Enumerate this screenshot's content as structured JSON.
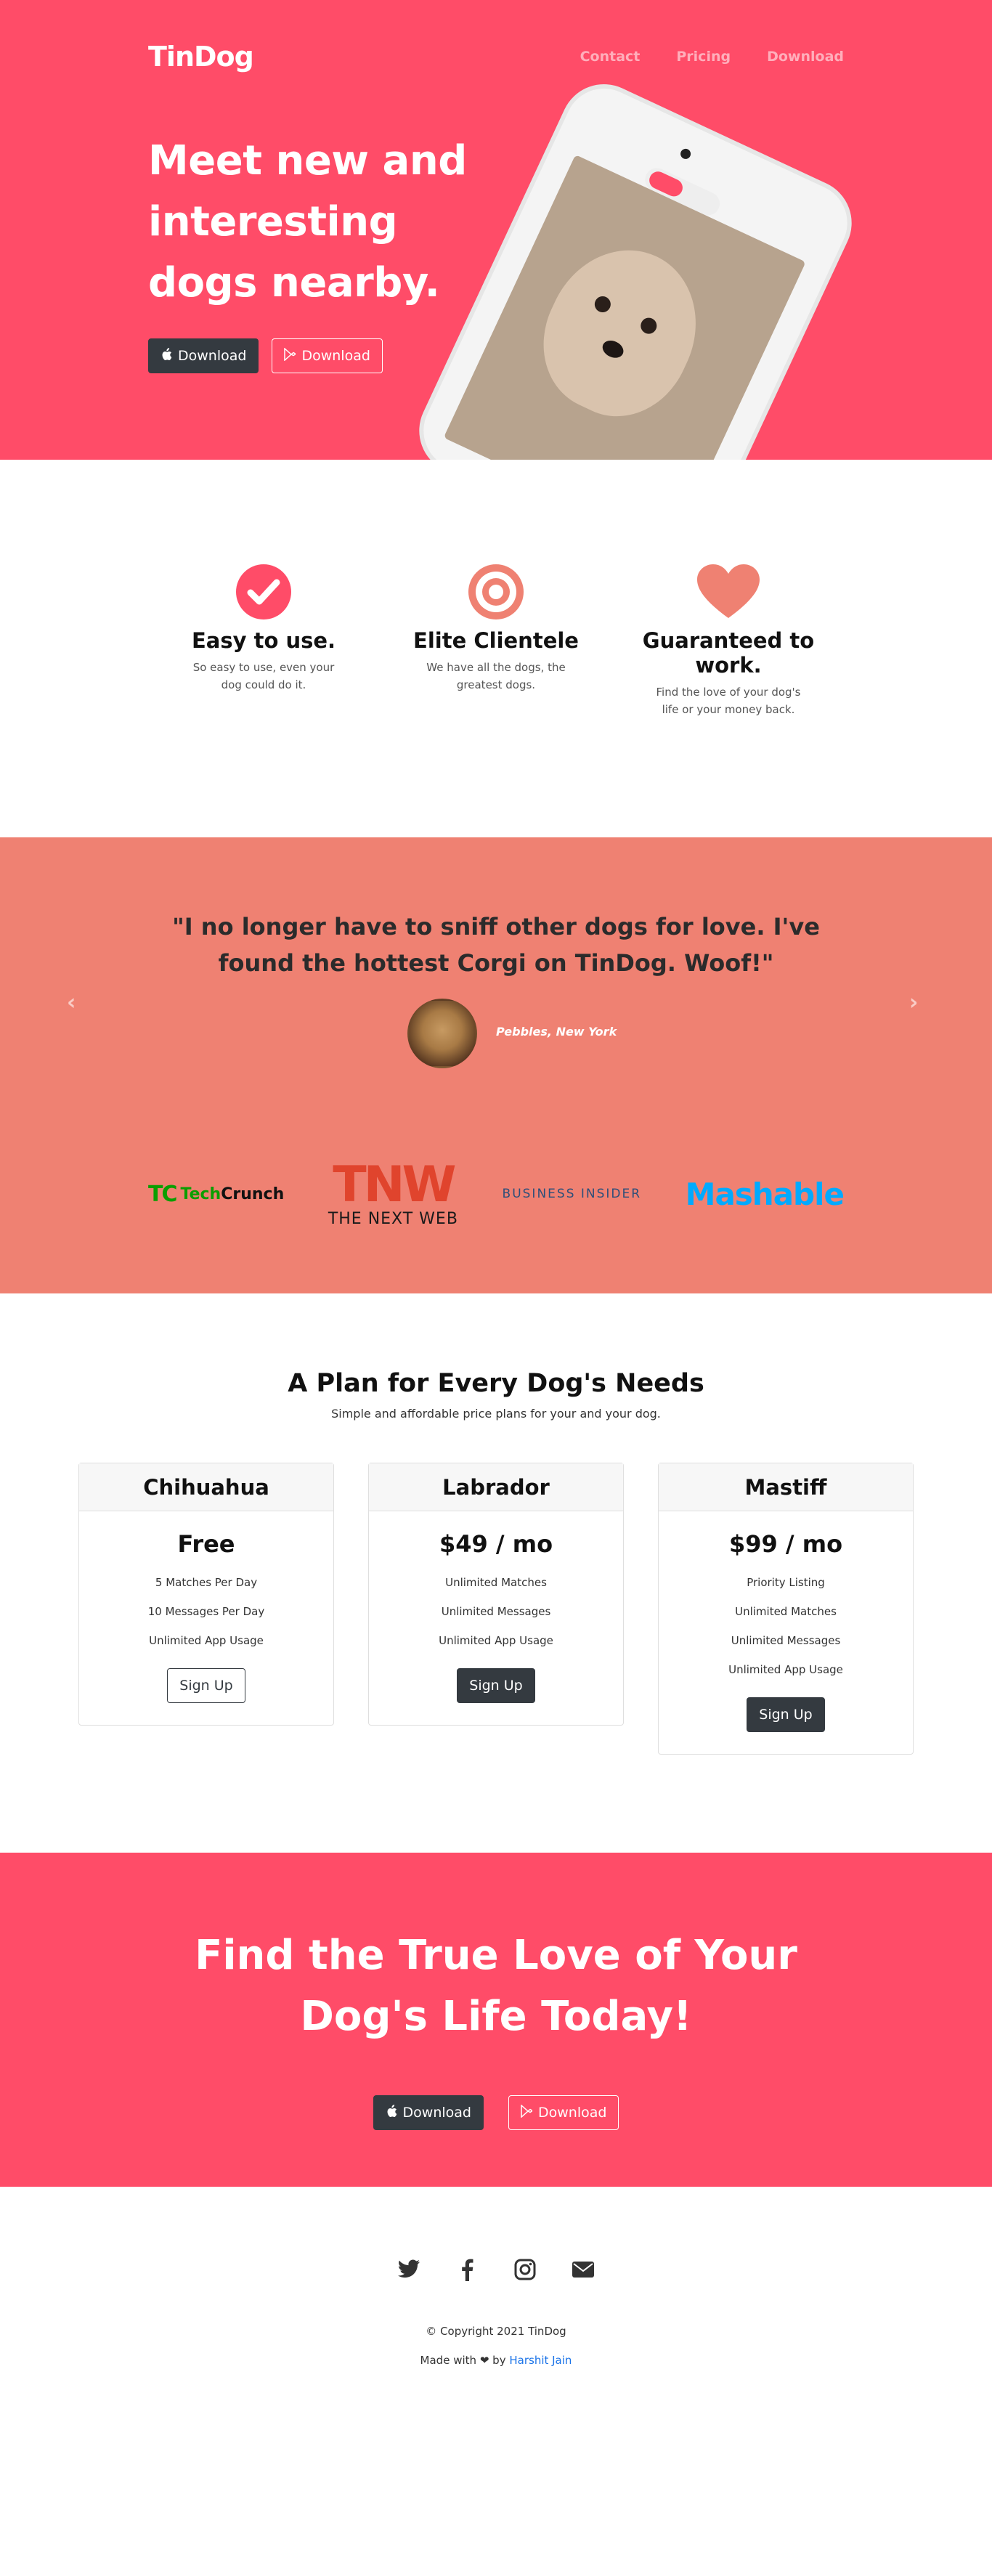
{
  "nav": {
    "brand": "TinDog",
    "links": [
      "Contact",
      "Pricing",
      "Download"
    ]
  },
  "hero": {
    "title": "Meet new and interesting dogs nearby.",
    "buttons": [
      "Download",
      "Download"
    ],
    "button_icons": [
      "apple-icon",
      "google-play-icon"
    ]
  },
  "features": [
    {
      "icon": "check-circle-icon",
      "title": "Easy to use.",
      "text": "So easy to use, even your dog could do it."
    },
    {
      "icon": "bullseye-icon",
      "title": "Elite Clientele",
      "text": "We have all the dogs, the greatest dogs."
    },
    {
      "icon": "heart-icon",
      "title": "Guaranteed to work.",
      "text": "Find the love of your dog's life or your money back."
    }
  ],
  "testimonial": {
    "quote": "\"I no longer have to sniff other dogs for love. I've found the hottest Corgi on TinDog. Woof!\"",
    "caption": "Pebbles, New York"
  },
  "press": {
    "techcrunch_mark": "TC",
    "techcrunch_word1": "Tech",
    "techcrunch_word2": "Crunch",
    "tnw_mark": "TNW",
    "tnw_sub": "THE NEXT WEB",
    "business_insider": "BUSINESS INSIDER",
    "mashable": "Mashable"
  },
  "pricing": {
    "title": "A Plan for Every Dog's Needs",
    "subtitle": "Simple and affordable price plans for your and your dog.",
    "plans": [
      {
        "name": "Chihuahua",
        "price": "Free",
        "features": [
          "5 Matches Per Day",
          "10 Messages Per Day",
          "Unlimited App Usage"
        ],
        "button": "Sign Up"
      },
      {
        "name": "Labrador",
        "price": "$49 / mo",
        "features": [
          "Unlimited Matches",
          "Unlimited Messages",
          "Unlimited App Usage"
        ],
        "button": "Sign Up"
      },
      {
        "name": "Mastiff",
        "price": "$99 / mo",
        "features": [
          "Priority Listing",
          "Unlimited Matches",
          "Unlimited Messages",
          "Unlimited App Usage"
        ],
        "button": "Sign Up"
      }
    ]
  },
  "cta": {
    "title": "Find the True Love of Your Dog's Life Today!",
    "buttons": [
      "Download",
      "Download"
    ]
  },
  "footer": {
    "social_icons": [
      "twitter-icon",
      "facebook-icon",
      "instagram-icon",
      "envelope-icon"
    ],
    "copyright": "© Copyright 2021 TinDog",
    "made_prefix": "Made with",
    "made_by": "by",
    "author": "Harshit Jain"
  },
  "colors": {
    "brand_red": "#ff4c68",
    "coral": "#ef8172",
    "dark": "#343a40"
  }
}
